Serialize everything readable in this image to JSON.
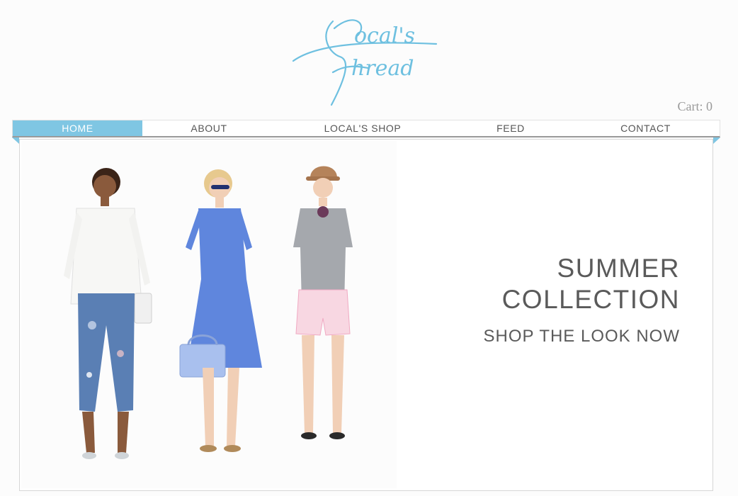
{
  "brand": {
    "logo_text": "Local's Thread",
    "accent_color": "#7fc6e3"
  },
  "cart": {
    "label": "Cart: 0"
  },
  "nav": {
    "items": [
      {
        "label": "HOME",
        "active": true
      },
      {
        "label": "ABOUT",
        "active": false
      },
      {
        "label": "LOCAL'S SHOP",
        "active": false
      },
      {
        "label": "FEED",
        "active": false
      },
      {
        "label": "CONTACT",
        "active": false
      }
    ]
  },
  "hero": {
    "title": "SUMMER\nCOLLECTION",
    "link": "SHOP THE LOOK NOW",
    "image": {
      "description": "three models wearing summer outfits"
    }
  }
}
